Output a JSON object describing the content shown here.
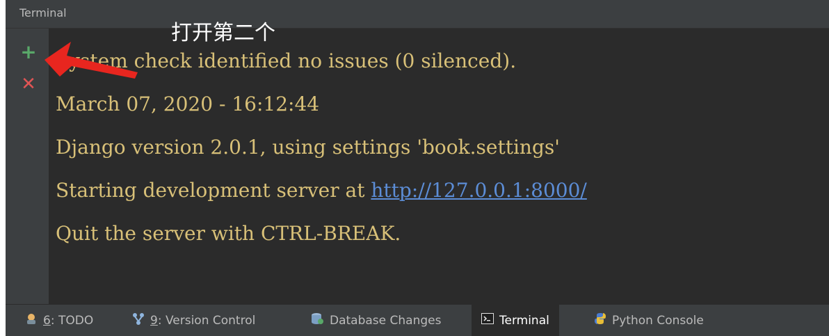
{
  "window": {
    "title": "Terminal"
  },
  "annotation": {
    "text": "打开第二个",
    "color": "#ffffff",
    "arrow_color": "#e8261f"
  },
  "toolbar": {
    "add_icon": "plus-icon",
    "close_icon": "close-icon"
  },
  "terminal": {
    "text_color": "#d8c078",
    "link_color": "#5c8dd6",
    "lines": [
      "System check identified no issues (0 silenced).",
      "March 07, 2020 - 16:12:44",
      "Django version 2.0.1, using settings 'book.settings'",
      "Starting development server at ",
      "Quit the server with CTRL-BREAK."
    ],
    "link": "http://127.0.0.1:8000/"
  },
  "bottom_tabs": [
    {
      "num": "6",
      "label": ": TODO",
      "icon": "todo-icon"
    },
    {
      "num": "9",
      "label": ": Version Control",
      "icon": "version-control-icon"
    },
    {
      "label": "Database Changes",
      "icon": "database-icon"
    },
    {
      "label": "Terminal",
      "icon": "terminal-icon",
      "active": true
    },
    {
      "label": "Python Console",
      "icon": "python-icon"
    }
  ]
}
